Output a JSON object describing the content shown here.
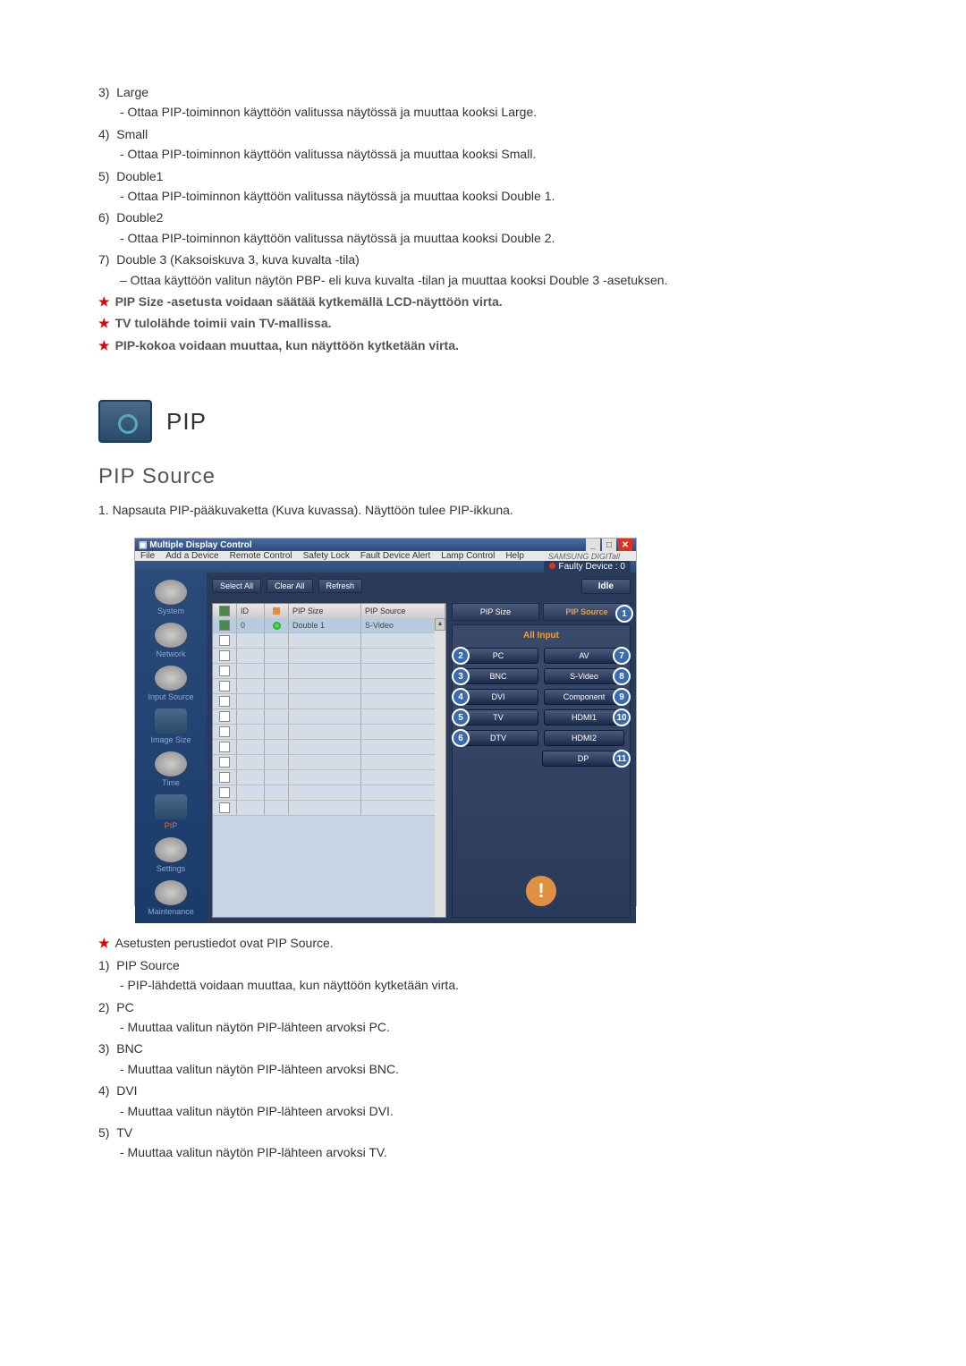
{
  "list1": {
    "i3": {
      "t": "Large",
      "d": "- Ottaa PIP-toiminnon käyttöön valitussa näytössä ja muuttaa kooksi Large."
    },
    "i4": {
      "t": "Small",
      "d": "- Ottaa PIP-toiminnon käyttöön valitussa näytössä ja muuttaa kooksi Small."
    },
    "i5": {
      "t": "Double1",
      "d": "- Ottaa PIP-toiminnon käyttöön valitussa näytössä ja muuttaa kooksi Double 1."
    },
    "i6": {
      "t": "Double2",
      "d": "- Ottaa PIP-toiminnon käyttöön valitussa näytössä ja muuttaa kooksi Double 2."
    },
    "i7": {
      "t": "Double 3 (Kaksoiskuva 3, kuva kuvalta -tila)",
      "d": "– Ottaa käyttöön valitun näytön PBP- eli kuva kuvalta -tilan ja muuttaa kooksi Double 3 -asetuksen."
    }
  },
  "notes1": {
    "n1": "PIP Size -asetusta voidaan säätää kytkemällä LCD-näyttöön virta.",
    "n2": "TV tulolähde toimii vain TV-mallissa.",
    "n3": "PIP-kokoa voidaan muuttaa, kun näyttöön kytketään virta."
  },
  "section": {
    "title": "PIP",
    "subheading": "PIP Source",
    "intro": "1.  Napsauta PIP-pääkuvaketta (Kuva kuvassa). Näyttöön tulee PIP-ikkuna."
  },
  "window": {
    "title": "Multiple Display Control",
    "menus": [
      "File",
      "Add a Device",
      "Remote Control",
      "Safety Lock",
      "Fault Device Alert",
      "Lamp Control",
      "Help"
    ],
    "brand": "SAMSUNG DIGITall",
    "faulty": "Faulty Device : 0",
    "toolbar": {
      "selectAll": "Select All",
      "clearAll": "Clear All",
      "refresh": "Refresh",
      "idle": "Idle"
    },
    "sidebar": [
      "System",
      "Network",
      "Input Source",
      "Image Size",
      "Time",
      "PIP",
      "Settings",
      "Maintenance"
    ],
    "columns": {
      "id": "ID",
      "size": "PIP Size",
      "source": "PIP Source"
    },
    "row": {
      "id": "0",
      "size": "Double 1",
      "source": "S-Video"
    },
    "panel": {
      "tabSize": "PIP Size",
      "tabSource": "PIP Source",
      "allInput": "All Input",
      "left": [
        "PC",
        "BNC",
        "DVI",
        "TV",
        "DTV"
      ],
      "right": [
        "AV",
        "S-Video",
        "Component",
        "HDMI1",
        "HDMI2",
        "DP"
      ]
    }
  },
  "notes2": {
    "n1": "Asetusten perustiedot ovat PIP Source."
  },
  "list2": {
    "i1": {
      "t": "PIP Source",
      "d": "- PIP-lähdettä voidaan muuttaa, kun näyttöön kytketään virta."
    },
    "i2": {
      "t": "PC",
      "d": "- Muuttaa valitun näytön PIP-lähteen arvoksi PC."
    },
    "i3": {
      "t": "BNC",
      "d": "- Muuttaa valitun näytön PIP-lähteen arvoksi BNC."
    },
    "i4": {
      "t": "DVI",
      "d": "- Muuttaa valitun näytön PIP-lähteen arvoksi DVI."
    },
    "i5": {
      "t": "TV",
      "d": "- Muuttaa valitun näytön PIP-lähteen arvoksi TV."
    }
  }
}
